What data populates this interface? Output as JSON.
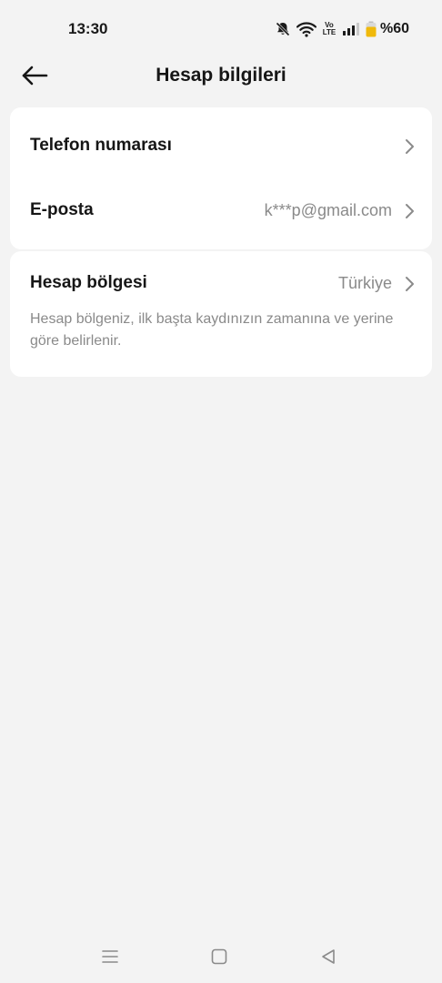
{
  "status_bar": {
    "time": "13:30",
    "volte_top": "Vo",
    "volte_bottom": "LTE",
    "battery_percent": "%60",
    "icons": [
      "bell-off-icon",
      "wifi-icon",
      "volte-icon",
      "signal-icon",
      "battery-icon"
    ],
    "battery_color": "#f0b90b"
  },
  "header": {
    "title": "Hesap bilgileri",
    "back_icon": "arrow-left-icon"
  },
  "account_rows": [
    {
      "label": "Telefon numarası",
      "value": ""
    },
    {
      "label": "E-posta",
      "value": "k***p@gmail.com"
    }
  ],
  "region": {
    "label": "Hesap bölgesi",
    "value": "Türkiye",
    "description": "Hesap bölgeniz, ilk başta kaydınızın zamanına ve yerine göre belirlenir."
  },
  "nav_bar": {
    "icons": [
      "menu-icon",
      "home-icon",
      "back-triangle-icon"
    ]
  }
}
